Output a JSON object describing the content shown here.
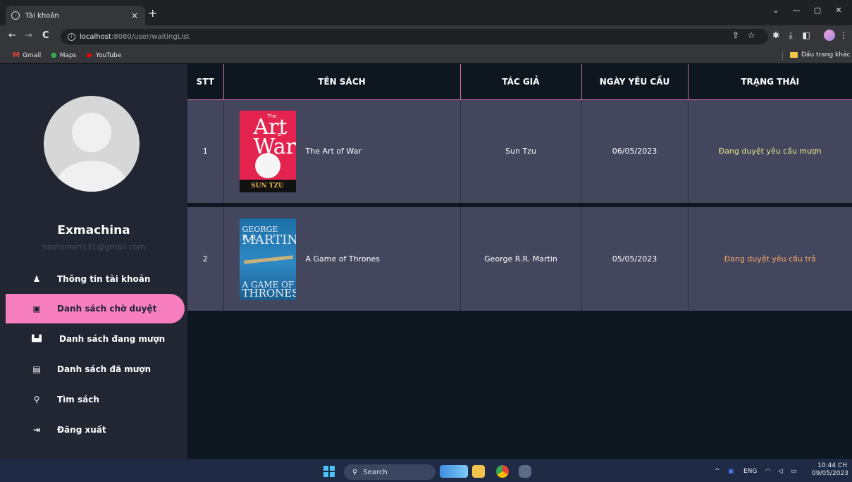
{
  "browser": {
    "tab_title": "Tài khoản",
    "tab_close": "×",
    "new_tab": "+",
    "url_host": "localhost",
    "url_path": ":8080/user/waitingList",
    "bookmarks": [
      "Gmail",
      "Maps",
      "YouTube"
    ],
    "other_bookmarks": "Dấu trang khác",
    "window_controls": [
      "⌄",
      "—",
      "▢",
      "✕"
    ],
    "nav": [
      "←",
      "→",
      "C"
    ]
  },
  "sidebar": {
    "username": "Exmachina",
    "email": "naotomori131@gmail.com",
    "items": [
      {
        "label": "Thông tin tài khoản",
        "icon": "user-icon",
        "glyph": "♟"
      },
      {
        "label": "Danh sách chờ duyệt",
        "icon": "book-bookmark-icon",
        "glyph": "▣"
      },
      {
        "label": "Danh sách đang mượn",
        "icon": "open-book-icon",
        "glyph": "▙▟"
      },
      {
        "label": "Danh sách đã mượn",
        "icon": "book-icon",
        "glyph": "▤"
      },
      {
        "label": "Tìm sách",
        "icon": "search-icon",
        "glyph": "⚲"
      },
      {
        "label": "Đăng xuất",
        "icon": "sign-out-icon",
        "glyph": "⇥"
      }
    ],
    "active_index": 1
  },
  "table": {
    "headers": [
      "STT",
      "TÊN SÁCH",
      "TÁC GIẢ",
      "NGÀY YÊU CẦU",
      "TRẠNG THÁI"
    ],
    "rows": [
      {
        "stt": "1",
        "title": "The Art of War",
        "author": "Sun Tzu",
        "date": "06/05/2023",
        "status": "Đang duyệt yêu cầu mượn",
        "cover_text": [
          "The",
          "Art",
          "of",
          "War",
          "SUN TZU"
        ]
      },
      {
        "stt": "2",
        "title": "A Game of Thrones",
        "author": "George R.R. Martin",
        "date": "05/05/2023",
        "status": "Đang duyệt yêu cầu trả",
        "cover_text": [
          "GEORGE R.R.",
          "MARTIN",
          "A GAME OF",
          "THRONES"
        ]
      }
    ]
  },
  "taskbar": {
    "search": "Search",
    "lang": "ENG",
    "time": "10:44 CH",
    "date": "09/05/2023"
  },
  "colors": {
    "accent": "#f77fc0",
    "status_borrow": "#e9e38a",
    "status_return": "#f4a86b",
    "sidebar_bg": "#222532",
    "row_bg": "#44465d"
  }
}
